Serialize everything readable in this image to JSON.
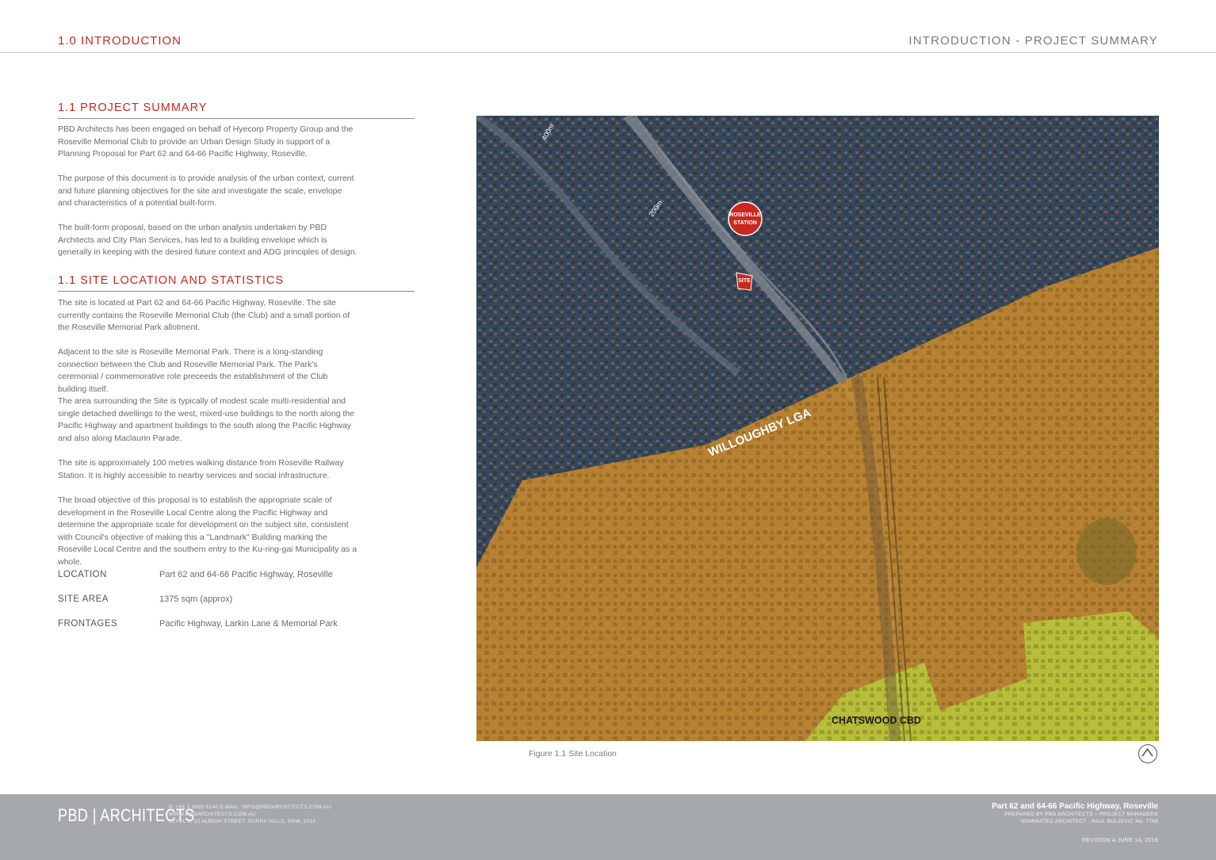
{
  "header": {
    "section": "1.0 INTRODUCTION",
    "page_title": "INTRODUCTION - PROJECT SUMMARY"
  },
  "summary": {
    "title": "1.1 PROJECT SUMMARY",
    "paragraphs": [
      "PBD Architects has been engaged on behalf of Hyecorp Property Group and the Roseville Memorial Club to provide an Urban Design Study in support of a Planning Proposal for Part 62 and 64-66 Pacific Highway, Roseville.",
      "The purpose of this document is to provide analysis of the urban context, current and future planning objectives for the site and investigate the scale, envelope and characteristics of a potential built-form.",
      "The built-form proposal, based on the urban analysis undertaken by PBD Architects and City Plan Services, has led to a building envelope which is generally in keeping with the desired future context and ADG principles of design."
    ]
  },
  "location": {
    "title": "1.1 SITE LOCATION AND STATISTICS",
    "paragraphs": [
      "The site is located at Part 62 and 64-66 Pacific Highway, Roseville. The site currently contains the Roseville Memorial Club (the Club) and a small portion of the Roseville Memorial Park allotment.",
      "Adjacent to the site is Roseville Memorial Park. There is a long-standing connection between the Club and Roseville Memorial Park. The Park's ceremonial / commemorative role preceeds the establishment of the Club building itself.",
      "The area surrounding the Site is typically of modest scale multi-residential and single detached dwellings to the west, mixed-use buildings to the north along the Pacific Highway and apartment buildings to the south along the Pacific Highway and also along Maclaurin Parade.",
      "The site is approximately 100 metres walking distance from Roseville Railway Station. It is highly accessible to nearby services and social infrastructure.",
      "The broad objective of this proposal is to establish the appropriate scale of development in the Roseville Local Centre along the Pacific Highway and determine the appropriate scale for development on the subject site, consistent with Council's objective of making this a \"Landmark\" Building marking the Roseville Local Centre and the southern entry to the Ku-ring-gai Municipality as a whole."
    ],
    "stats": [
      {
        "label": "LOCATION",
        "value": "Part 62 and 64-66 Pacific Highway, Roseville"
      },
      {
        "label": "SITE AREA",
        "value": "1375 sqm (approx)"
      },
      {
        "label": "FRONTAGES",
        "value": "Pacific Highway, Larkin Lane & Memorial Park"
      }
    ]
  },
  "map": {
    "labels": {
      "station": [
        "ROSEVILLE",
        "STATION"
      ],
      "site": "SITE",
      "lga": "WILLOUGHBY LGA",
      "cbd": "CHATSWOOD CBD",
      "radius_400": "400m",
      "radius_200": "200m"
    },
    "colors": {
      "lga_fill": "#c88a2c",
      "cbd_fill": "#b8c43a",
      "base": "#36465c",
      "marker": "#c8281f"
    },
    "caption": "Figure 1.1 Site Location",
    "north_icon": "north-arrow-icon"
  },
  "footer": {
    "logo": "PBD | ARCHITECTS",
    "contact": [
      "P: +61 2 9698 8140     E-MAIL: INFO@PBDARCHITECTS.COM.AU",
      "WWW.PBDARCHITECTS.COM.AU",
      "LEVEL 2, 52 ALBION STREET, SURRY HILLS, NSW, 2010"
    ],
    "project_title": "Part 62 and 64-66 Pacific Highway, Roseville",
    "prepared_by": "PREPARED BY PBD ARCHITECTS – PROJECT MANAGERS",
    "nominated": "NOMINATED ARCHITECT - PAUL BULJEVIC   No. 7768",
    "revision": "REVISION A    JUNE 14, 2018"
  }
}
